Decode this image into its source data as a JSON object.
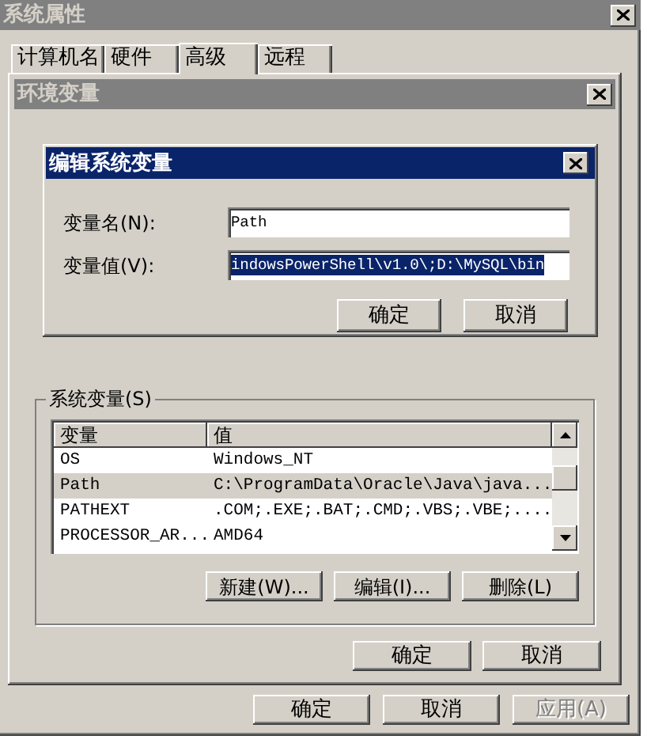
{
  "window": {
    "title": "系统属性"
  },
  "tabs": [
    {
      "label": "计算机名",
      "selected": false
    },
    {
      "label": "硬件",
      "selected": false
    },
    {
      "label": "高级",
      "selected": true
    },
    {
      "label": "远程",
      "selected": false
    }
  ],
  "env_dialog": {
    "title": "环境变量",
    "buttons": [
      "确定",
      "取消"
    ]
  },
  "edit_dialog": {
    "title": "编辑系统变量",
    "fields": [
      {
        "label": "变量名(N):",
        "value": "Path",
        "selected": false
      },
      {
        "label": "变量值(V):",
        "value": "indowsPowerShell\\v1.0\\;D:\\MySQL\\bin",
        "selected": true
      }
    ],
    "buttons": [
      "确定",
      "取消"
    ]
  },
  "system_variables": {
    "title": "系统变量(S)",
    "columns": [
      "变量",
      "值"
    ],
    "rows": [
      {
        "cells": [
          "OS",
          "Windows_NT"
        ],
        "selected": false
      },
      {
        "cells": [
          "Path",
          "C:\\ProgramData\\Oracle\\Java\\java..."
        ],
        "selected": true
      },
      {
        "cells": [
          "PATHEXT",
          ".COM;.EXE;.BAT;.CMD;.VBS;.VBE;...."
        ],
        "selected": false
      },
      {
        "cells": [
          "PROCESSOR_AR...",
          "AMD64"
        ],
        "selected": false
      }
    ],
    "buttons": [
      "新建(W)...",
      "编辑(I)...",
      "删除(L)"
    ]
  },
  "buttons": [
    {
      "label": "确定",
      "disabled": false
    },
    {
      "label": "取消",
      "disabled": false
    },
    {
      "label": "应用(A)",
      "disabled": true
    }
  ]
}
